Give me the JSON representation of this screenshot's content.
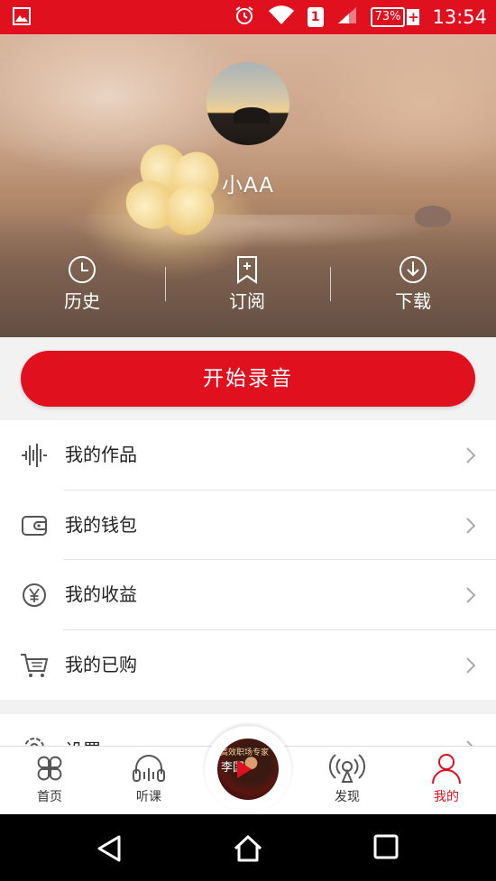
{
  "status_bar": {
    "time": "13:54",
    "battery": "73%",
    "sim": "1",
    "icons": [
      "image-icon",
      "alarm-icon",
      "wifi-icon",
      "sim-icon",
      "signal-icon",
      "battery-icon"
    ]
  },
  "profile": {
    "username": "小AA"
  },
  "quick_actions": [
    {
      "label": "历史",
      "icon": "clock-icon"
    },
    {
      "label": "订阅",
      "icon": "bookmark-add-icon"
    },
    {
      "label": "下载",
      "icon": "download-icon"
    }
  ],
  "record_button": "开始录音",
  "menu": [
    {
      "label": "我的作品",
      "icon": "waveform-icon"
    },
    {
      "label": "我的钱包",
      "icon": "wallet-icon"
    },
    {
      "label": "我的收益",
      "icon": "yen-icon"
    },
    {
      "label": "我的已购",
      "icon": "cart-icon"
    }
  ],
  "settings_label": "设置",
  "tabs": [
    {
      "label": "首页",
      "icon": "home-clover-icon"
    },
    {
      "label": "听课",
      "icon": "headphones-icon"
    },
    {
      "label": "发现",
      "icon": "broadcast-icon"
    },
    {
      "label": "我的",
      "icon": "person-icon",
      "active": true
    }
  ],
  "center_cover": {
    "line1": "高效职场专家",
    "line2": "李国"
  },
  "colors": {
    "brand_red": "#e0101f"
  }
}
